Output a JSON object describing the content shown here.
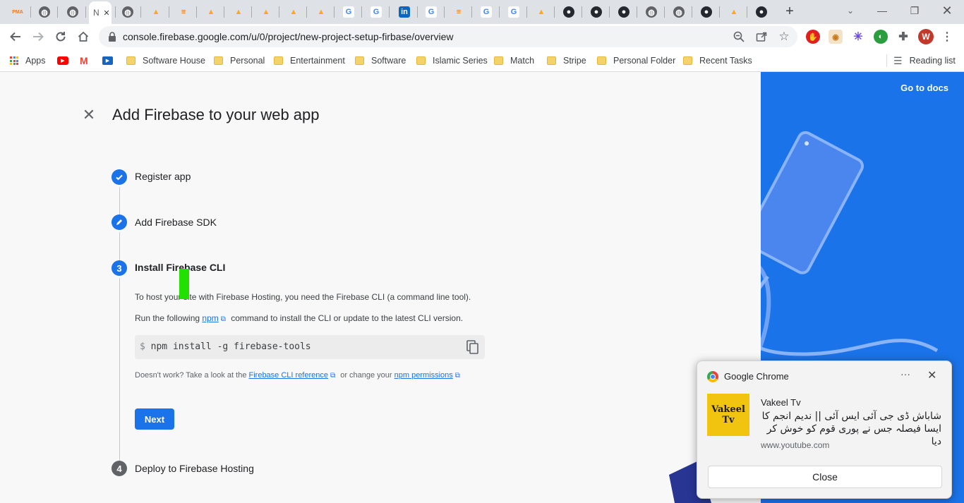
{
  "browser": {
    "tabs": [
      {
        "icon": "phpmyadmin-icon",
        "label": "PMA"
      },
      {
        "icon": "globe-icon"
      },
      {
        "icon": "globe-icon"
      },
      {
        "icon": "page-icon",
        "label": "N",
        "active": true
      },
      {
        "icon": "globe-icon"
      },
      {
        "icon": "firebase-icon"
      },
      {
        "icon": "stackoverflow-icon"
      },
      {
        "icon": "firebase-icon"
      },
      {
        "icon": "firebase-icon"
      },
      {
        "icon": "firebase-icon"
      },
      {
        "icon": "firebase-icon"
      },
      {
        "icon": "firebase-icon"
      },
      {
        "icon": "google-icon",
        "label": "G"
      },
      {
        "icon": "google-icon",
        "label": "G"
      },
      {
        "icon": "linkedin-icon",
        "label": "in"
      },
      {
        "icon": "google-icon",
        "label": "G"
      },
      {
        "icon": "stackoverflow-icon"
      },
      {
        "icon": "google-icon",
        "label": "G"
      },
      {
        "icon": "google-icon",
        "label": "G"
      },
      {
        "icon": "firebase-icon"
      },
      {
        "icon": "github-icon"
      },
      {
        "icon": "github-icon"
      },
      {
        "icon": "github-icon"
      },
      {
        "icon": "globe-icon"
      },
      {
        "icon": "globe-icon"
      },
      {
        "icon": "github-icon"
      },
      {
        "icon": "firebase-icon"
      },
      {
        "icon": "github-icon"
      }
    ],
    "new_tab": "+",
    "url": "console.firebase.google.com/u/0/project/new-project-setup-firbase/overview",
    "profile_initial": "W",
    "colors": {
      "accent": "#1a73e8",
      "tab_strip": "#dee1e6"
    }
  },
  "bookmarks": {
    "apps_label": "Apps",
    "items": [
      {
        "label": "Software House"
      },
      {
        "label": "Personal"
      },
      {
        "label": "Entertainment"
      },
      {
        "label": "Software"
      },
      {
        "label": "Islamic Series"
      },
      {
        "label": "Match"
      },
      {
        "label": "Stripe"
      },
      {
        "label": "Personal Folder"
      },
      {
        "label": "Recent Tasks"
      }
    ],
    "reading_list": "Reading list"
  },
  "page": {
    "title": "Add Firebase to your web app",
    "go_to_docs": "Go to docs",
    "steps": [
      {
        "number": "",
        "label": "Register app",
        "state": "done"
      },
      {
        "number": "",
        "label": "Add Firebase SDK",
        "state": "edit"
      },
      {
        "number": "3",
        "label": "Install Firebase CLI",
        "state": "active"
      },
      {
        "number": "4",
        "label": "Deploy to Firebase Hosting",
        "state": "pending"
      }
    ],
    "step3": {
      "intro": "To host your site with Firebase Hosting, you need the Firebase CLI (a command line tool).",
      "run_prefix": "Run the following",
      "npm_link": "npm",
      "run_suffix": "command to install the CLI or update to the latest CLI version.",
      "prompt": "$",
      "command": "npm install -g firebase-tools",
      "help_prefix": "Doesn't work? Take a look at the",
      "cli_reference_link": "Firebase CLI reference",
      "help_middle": "or change your",
      "npm_permissions_link": "npm permissions",
      "next_button": "Next"
    }
  },
  "notification": {
    "app_name": "Google Chrome",
    "menu": "···",
    "thumbnail_text": [
      "Vakeel",
      "Tv"
    ],
    "title": "Vakeel Tv",
    "body": "شاباش ڈی جی آئی ایس آئی || ندیم انجم کا ایسا فیصلہ جس نے پوری قوم کو خوش کر دیا",
    "site": "www.youtube.com",
    "close_button": "Close"
  }
}
